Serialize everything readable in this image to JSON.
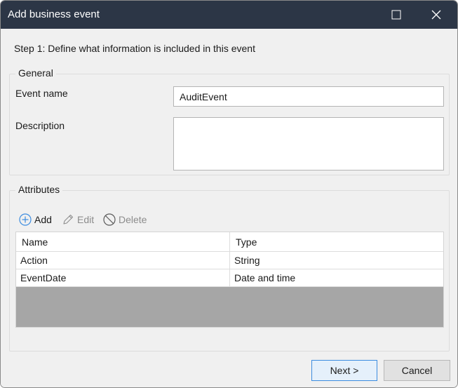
{
  "window": {
    "title": "Add business event"
  },
  "step_text": "Step 1: Define what information is included in this event",
  "general": {
    "legend": "General",
    "event_name_label": "Event name",
    "event_name_value": "AuditEvent",
    "description_label": "Description",
    "description_value": ""
  },
  "attributes": {
    "legend": "Attributes",
    "toolbar": {
      "add_label": "Add",
      "edit_label": "Edit",
      "delete_label": "Delete"
    },
    "columns": [
      "Name",
      "Type"
    ],
    "rows": [
      {
        "name": "Action",
        "type": "String"
      },
      {
        "name": "EventDate",
        "type": "Date and time"
      }
    ]
  },
  "footer": {
    "next_label": "Next >",
    "cancel_label": "Cancel"
  },
  "icons": {
    "add": "plus-circle-icon",
    "edit": "pencil-icon",
    "delete": "prohibited-icon",
    "maximize": "maximize-icon",
    "close": "close-icon"
  },
  "colors": {
    "titlebar": "#2c3646",
    "accent": "#3c8ce0",
    "dialog_bg": "#f0f0f0",
    "grid_empty": "#a6a6a6"
  }
}
